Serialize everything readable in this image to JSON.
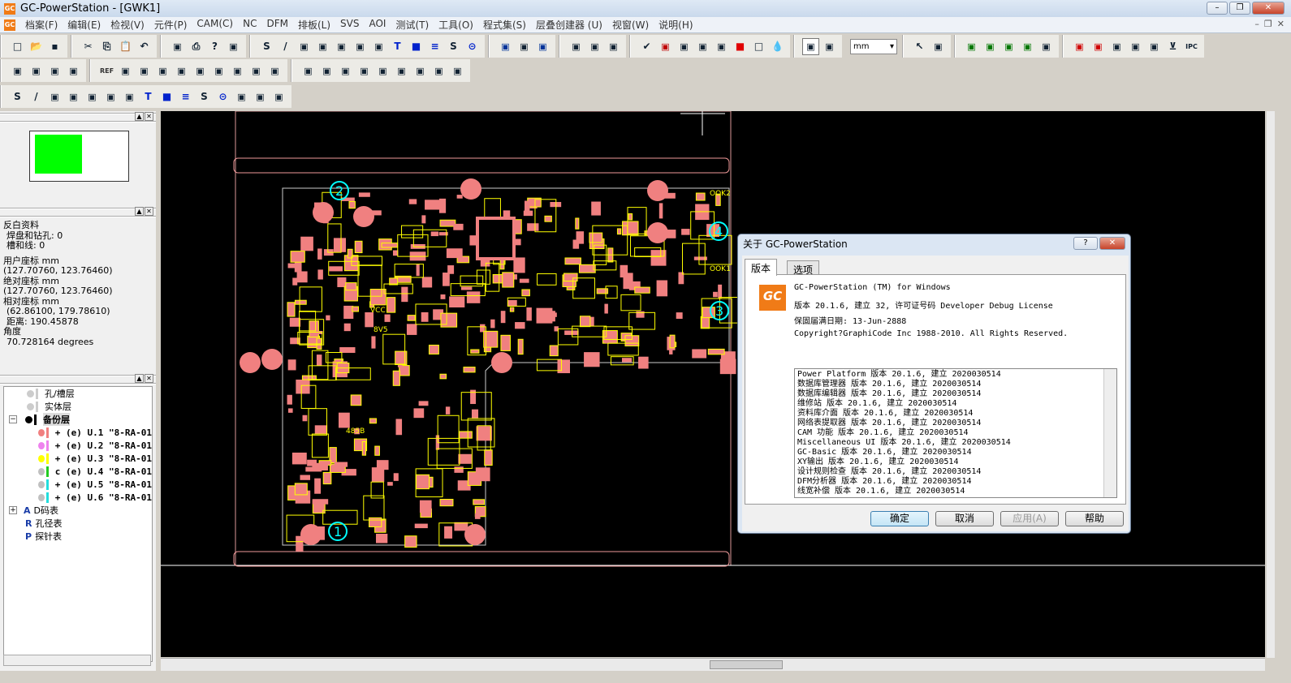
{
  "app": {
    "title": "GC-PowerStation - [GWK1]",
    "logo": "GC"
  },
  "menu": [
    "档案(F)",
    "编辑(E)",
    "检视(V)",
    "元件(P)",
    "CAM(C)",
    "NC",
    "DFM",
    "排板(L)",
    "SVS",
    "AOI",
    "测试(T)",
    "工具(O)",
    "程式集(S)",
    "层叠创建器 (U)",
    "视窗(W)",
    "说明(H)"
  ],
  "toolbar": {
    "unit_select": "mm",
    "row1": [
      [
        "new",
        "open",
        "save"
      ],
      [
        "cut",
        "copy",
        "paste",
        "undo"
      ],
      [
        "print-preview",
        "print",
        "help",
        "context-help"
      ],
      [
        "S",
        "line",
        "pad",
        "arc",
        "poly",
        "route",
        "via",
        "T",
        "rect",
        "fill",
        "S2",
        "circle"
      ],
      [
        "view1",
        "view2",
        "view3"
      ],
      [
        "fit",
        "zoom-in",
        "zoom-out"
      ],
      [
        "check",
        "drc",
        "net",
        "layer",
        "layer2",
        "red",
        "square",
        "drop"
      ],
      [
        "snap",
        "angle"
      ],
      [
        "select",
        "edit"
      ],
      [
        "grid1",
        "grid2",
        "chip",
        "comp",
        "find"
      ],
      [
        "r1",
        "r2",
        "r3",
        "r4",
        "r5",
        "filter",
        "IPC"
      ]
    ],
    "row2a": [
      [
        "sel-box",
        "sel-f",
        "sel-grid",
        "sel-arrow"
      ]
    ],
    "row2b": [
      [
        "REF",
        "p1",
        "p2",
        "p3",
        "p4",
        "p5",
        "p6",
        "p7",
        "p8",
        "p9"
      ],
      [
        "f1",
        "f2",
        "f3",
        "f4",
        "f5",
        "f6",
        "f7",
        "f8",
        "f9"
      ]
    ],
    "row3": [
      [
        "S",
        "line",
        "pad",
        "arc",
        "poly",
        "route",
        "via",
        "T",
        "rect",
        "fill",
        "S2",
        "circle",
        "p",
        "bars",
        "pencil"
      ]
    ]
  },
  "left_panel": {
    "info": {
      "title": "反白资料",
      "pads_drills": "焊盘和钻孔: 0",
      "slots_lines": "槽和线: 0",
      "user_coord_label": "用户座标 mm",
      "user_coord": "(127.70760, 123.76460)",
      "abs_coord_label": "绝对座标 mm",
      "abs_coord": "(127.70760, 123.76460)",
      "rel_coord_label": "相对座标 mm",
      "rel_coord": "(62.86100, 179.78610)",
      "distance": "距离: 190.45878",
      "angle_label": "角度",
      "angle": "70.728164 degrees"
    },
    "tree": {
      "holes": "孔/槽层",
      "solid": "实体层",
      "backup": "备份层",
      "layers": [
        {
          "text": "+ (e) U.1 \"8-RA-01",
          "dot": "#f08080",
          "bar": "#f08080"
        },
        {
          "text": "+ (e) U.2 \"8-RA-01",
          "dot": "#ee82ee",
          "bar": "#ee82ee"
        },
        {
          "text": "+ (e) U.3 \"8-RA-01",
          "dot": "#ffff00",
          "bar": "#ffff00"
        },
        {
          "text": "c (e) U.4 \"8-RA-01",
          "dot": "#c0c0c0",
          "bar": "#22cc22"
        },
        {
          "text": "+ (e) U.5 \"8-RA-01",
          "dot": "#c0c0c0",
          "bar": "#22dddd"
        },
        {
          "text": "+ (e) U.6 \"8-RA-01",
          "dot": "#c0c0c0",
          "bar": "#22dddd"
        }
      ],
      "dcode": "D码表",
      "drill": "孔径表",
      "probe": "探针表"
    }
  },
  "dialog": {
    "title": "关于 GC-PowerStation",
    "tabs": [
      "版本",
      "选项"
    ],
    "logo": "GC",
    "product": "GC-PowerStation (TM) for Windows",
    "version": "版本 20.1.6, 建立 32, 许可证号码 Developer Debug License",
    "warranty": "保固届满日期: 13-Jun-2888",
    "copyright": "Copyright?GraphiCode Inc 1988-2010. All Rights Reserved.",
    "components": [
      "Power Platform 版本 20.1.6, 建立 2020030514",
      "数据库管理器 版本 20.1.6, 建立 2020030514",
      "数据库编辑器 版本 20.1.6, 建立 2020030514",
      "维修站 版本 20.1.6, 建立 2020030514",
      "资料库介面 版本 20.1.6, 建立 2020030514",
      "网络表提取器 版本 20.1.6, 建立 2020030514",
      "CAM 功能 版本 20.1.6, 建立 2020030514",
      "Miscellaneous UI 版本 20.1.6, 建立 2020030514",
      "GC-Basic 版本 20.1.6, 建立 2020030514",
      "XY输出 版本 20.1.6, 建立 2020030514",
      "设计规则检查 版本 20.1.6, 建立 2020030514",
      "DFM分析器 版本 20.1.6, 建立 2020030514",
      "线宽补偿 版本 20.1.6, 建立 2020030514"
    ],
    "buttons": {
      "ok": "确定",
      "cancel": "取消",
      "apply": "应用(A)",
      "help": "帮助"
    }
  },
  "pcb": {
    "labels": [
      "VCC",
      "8V5",
      "485B",
      "OOK2",
      "OOK1"
    ],
    "markers": [
      "1",
      "2",
      "3",
      "4"
    ]
  }
}
